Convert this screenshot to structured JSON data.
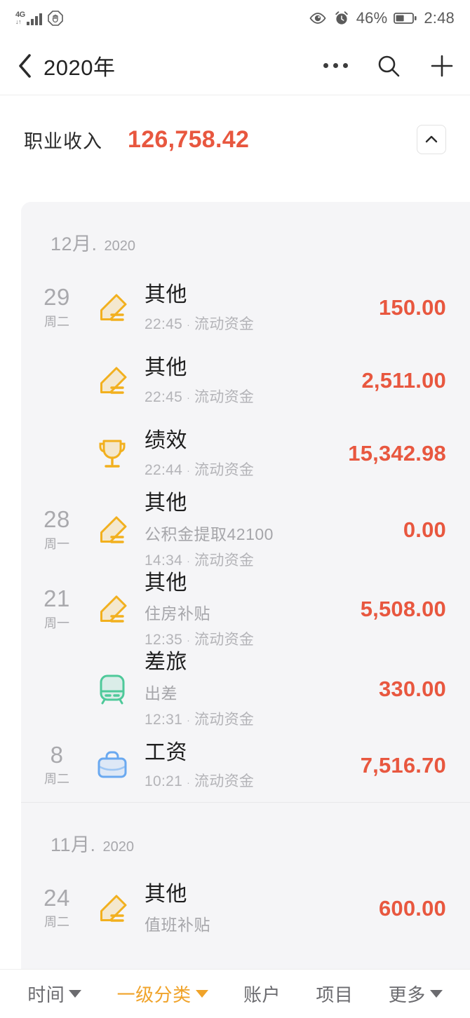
{
  "statusbar": {
    "network_label_top": "4G",
    "network_label_bottom": "↓↑",
    "signal_icon": "signal-bars-icon",
    "dnd_icon": "do-not-disturb-icon",
    "eye_icon": "eye-icon",
    "alarm_icon": "alarm-clock-icon",
    "battery_percent": "46%",
    "battery_icon": "battery-icon",
    "time": "2:48"
  },
  "navbar": {
    "back_icon": "chevron-left-icon",
    "title": "2020年",
    "more_icon": "more-dots-icon",
    "search_icon": "search-icon",
    "add_icon": "plus-icon"
  },
  "summary": {
    "label": "职业收入",
    "amount": "126,758.42",
    "amount_color": "#e8573f",
    "collapse_icon": "chevron-up-icon"
  },
  "months": [
    {
      "month": "12月.",
      "year": "2020",
      "rows": [
        {
          "day": "29",
          "weekday": "周二",
          "icon": "tag-icon",
          "icon_color": "#f2b01e",
          "category": "其他",
          "memo": "",
          "time": "22:45",
          "account": "流动资金",
          "amount": "150.00"
        },
        {
          "day": "",
          "weekday": "",
          "icon": "tag-icon",
          "icon_color": "#f2b01e",
          "category": "其他",
          "memo": "",
          "time": "22:45",
          "account": "流动资金",
          "amount": "2,511.00"
        },
        {
          "day": "",
          "weekday": "",
          "icon": "trophy-icon",
          "icon_color": "#f2b01e",
          "category": "绩效",
          "memo": "",
          "time": "22:44",
          "account": "流动资金",
          "amount": "15,342.98"
        },
        {
          "day": "28",
          "weekday": "周一",
          "icon": "tag-icon",
          "icon_color": "#f2b01e",
          "category": "其他",
          "memo": "公积金提取42100",
          "time": "14:34",
          "account": "流动资金",
          "amount": "0.00"
        },
        {
          "day": "21",
          "weekday": "周一",
          "icon": "tag-icon",
          "icon_color": "#f2b01e",
          "category": "其他",
          "memo": "住房补贴",
          "time": "12:35",
          "account": "流动资金",
          "amount": "5,508.00"
        },
        {
          "day": "",
          "weekday": "",
          "icon": "train-icon",
          "icon_color": "#4ec99a",
          "category": "差旅",
          "memo": "出差",
          "time": "12:31",
          "account": "流动资金",
          "amount": "330.00"
        },
        {
          "day": "8",
          "weekday": "周二",
          "icon": "briefcase-icon",
          "icon_color": "#6aa9f0",
          "category": "工资",
          "memo": "",
          "time": "10:21",
          "account": "流动资金",
          "amount": "7,516.70"
        }
      ]
    },
    {
      "month": "11月.",
      "year": "2020",
      "rows": [
        {
          "day": "24",
          "weekday": "周二",
          "icon": "tag-icon",
          "icon_color": "#f2b01e",
          "category": "其他",
          "memo": "值班补贴",
          "time": "",
          "account": "",
          "amount": "600.00"
        }
      ]
    }
  ],
  "toolbar": {
    "items": [
      {
        "label": "时间",
        "caret": true,
        "active": false
      },
      {
        "label": "一级分类",
        "caret": true,
        "active": true
      },
      {
        "label": "账户",
        "caret": false,
        "active": false
      },
      {
        "label": "项目",
        "caret": false,
        "active": false
      },
      {
        "label": "更多",
        "caret": true,
        "active": false
      }
    ],
    "active_color": "#f0a32a"
  }
}
